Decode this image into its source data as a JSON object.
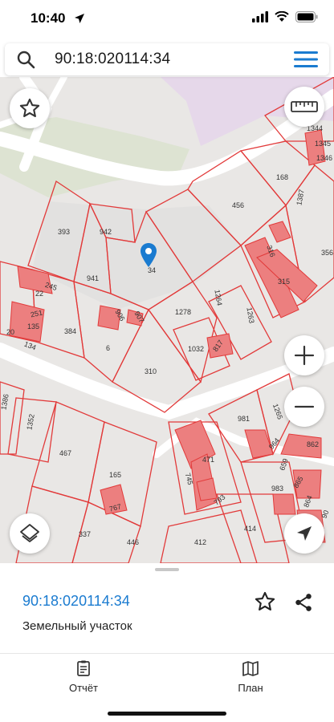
{
  "status": {
    "time": "10:40"
  },
  "search": {
    "query": "90:18:020114:34"
  },
  "map": {
    "plot_labels": [
      "393",
      "942",
      "941",
      "34",
      "22",
      "245",
      "251",
      "135",
      "20",
      "134",
      "384",
      "906",
      "907",
      "6",
      "1278",
      "1264",
      "1263",
      "1032",
      "817",
      "310",
      "456",
      "168",
      "1387",
      "316",
      "356",
      "315",
      "1344",
      "1345",
      "1346",
      "981",
      "1265",
      "1352",
      "1386",
      "467",
      "165",
      "767",
      "471",
      "745",
      "793",
      "983",
      "964",
      "659",
      "862",
      "865",
      "864",
      "90",
      "337",
      "446",
      "412",
      "414"
    ],
    "colors": {
      "boundary": "#e23a3a",
      "building_fill": "#ec7f7f",
      "road": "#ffffff",
      "park": "#dde3d2",
      "zone": "#e6d8ea",
      "accent": "#1a7bd0"
    }
  },
  "sheet": {
    "cad_number": "90:18:020114:34",
    "object_type": "Земельный участок"
  },
  "tabs": [
    {
      "label": "Отчёт",
      "icon": "report-icon"
    },
    {
      "label": "План",
      "icon": "map-plan-icon"
    }
  ]
}
